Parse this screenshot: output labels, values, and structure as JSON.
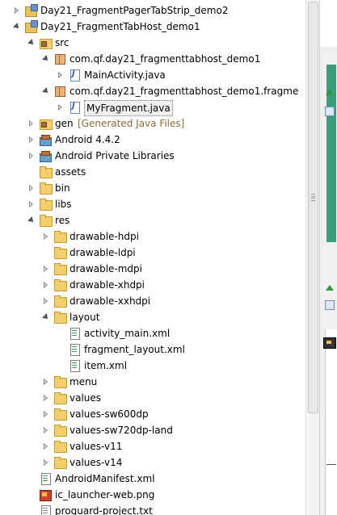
{
  "tree": [
    {
      "label": "Day21_FragmentPagerTabStrip_demo2",
      "icon": "project-icon",
      "state": "collapsed",
      "level": 0
    },
    {
      "label": "Day21_FragmentTabHost_demo1",
      "icon": "project-icon",
      "state": "expanded",
      "level": 0
    },
    {
      "label": "src",
      "icon": "source-folder-icon",
      "state": "expanded",
      "level": 1
    },
    {
      "label": "com.qf.day21_fragmenttabhost_demo1",
      "icon": "package-icon",
      "state": "expanded",
      "level": 2
    },
    {
      "label": "MainActivity.java",
      "icon": "java-file-icon",
      "state": "collapsed",
      "level": 3
    },
    {
      "label": "com.qf.day21_fragmenttabhost_demo1.fragme",
      "icon": "package-icon",
      "state": "expanded",
      "level": 2
    },
    {
      "label": "MyFragment.java",
      "icon": "java-file-icon",
      "state": "collapsed",
      "level": 3,
      "selected": true
    },
    {
      "label": "gen",
      "suffix": "[Generated Java Files]",
      "icon": "source-folder-icon",
      "state": "collapsed",
      "level": 1
    },
    {
      "label": "Android 4.4.2",
      "icon": "library-icon",
      "state": "collapsed",
      "level": 1
    },
    {
      "label": "Android Private Libraries",
      "icon": "library-icon",
      "state": "collapsed",
      "level": 1
    },
    {
      "label": "assets",
      "icon": "folder-icon",
      "state": "none",
      "level": 1
    },
    {
      "label": "bin",
      "icon": "folder-icon",
      "state": "collapsed",
      "level": 1
    },
    {
      "label": "libs",
      "icon": "folder-icon",
      "state": "collapsed",
      "level": 1
    },
    {
      "label": "res",
      "icon": "folder-icon",
      "state": "expanded",
      "level": 1
    },
    {
      "label": "drawable-hdpi",
      "icon": "folder-icon",
      "state": "collapsed",
      "level": 2
    },
    {
      "label": "drawable-ldpi",
      "icon": "folder-icon",
      "state": "none",
      "level": 2
    },
    {
      "label": "drawable-mdpi",
      "icon": "folder-icon",
      "state": "collapsed",
      "level": 2
    },
    {
      "label": "drawable-xhdpi",
      "icon": "folder-icon",
      "state": "collapsed",
      "level": 2
    },
    {
      "label": "drawable-xxhdpi",
      "icon": "folder-icon",
      "state": "collapsed",
      "level": 2
    },
    {
      "label": "layout",
      "icon": "folder-icon",
      "state": "expanded",
      "level": 2
    },
    {
      "label": "activity_main.xml",
      "icon": "xml-file-icon",
      "state": "none",
      "level": 3
    },
    {
      "label": "fragment_layout.xml",
      "icon": "xml-file-icon",
      "state": "none",
      "level": 3
    },
    {
      "label": "item.xml",
      "icon": "xml-file-icon",
      "state": "none",
      "level": 3
    },
    {
      "label": "menu",
      "icon": "folder-icon",
      "state": "collapsed",
      "level": 2
    },
    {
      "label": "values",
      "icon": "folder-icon",
      "state": "collapsed",
      "level": 2
    },
    {
      "label": "values-sw600dp",
      "icon": "folder-icon",
      "state": "collapsed",
      "level": 2
    },
    {
      "label": "values-sw720dp-land",
      "icon": "folder-icon",
      "state": "collapsed",
      "level": 2
    },
    {
      "label": "values-v11",
      "icon": "folder-icon",
      "state": "collapsed",
      "level": 2
    },
    {
      "label": "values-v14",
      "icon": "folder-icon",
      "state": "collapsed",
      "level": 2
    },
    {
      "label": "AndroidManifest.xml",
      "icon": "xml-file-icon",
      "state": "none",
      "level": 1
    },
    {
      "label": "ic_launcher-web.png",
      "icon": "png-file-icon",
      "state": "none",
      "level": 1
    },
    {
      "label": "proguard-project.txt",
      "icon": "text-file-icon",
      "state": "none",
      "level": 1
    }
  ],
  "colors": {
    "suffix_text": "#8a6d3b",
    "right_panel_accent": "#3a9e7a",
    "scroll_thumb": "#e8e8e8"
  }
}
